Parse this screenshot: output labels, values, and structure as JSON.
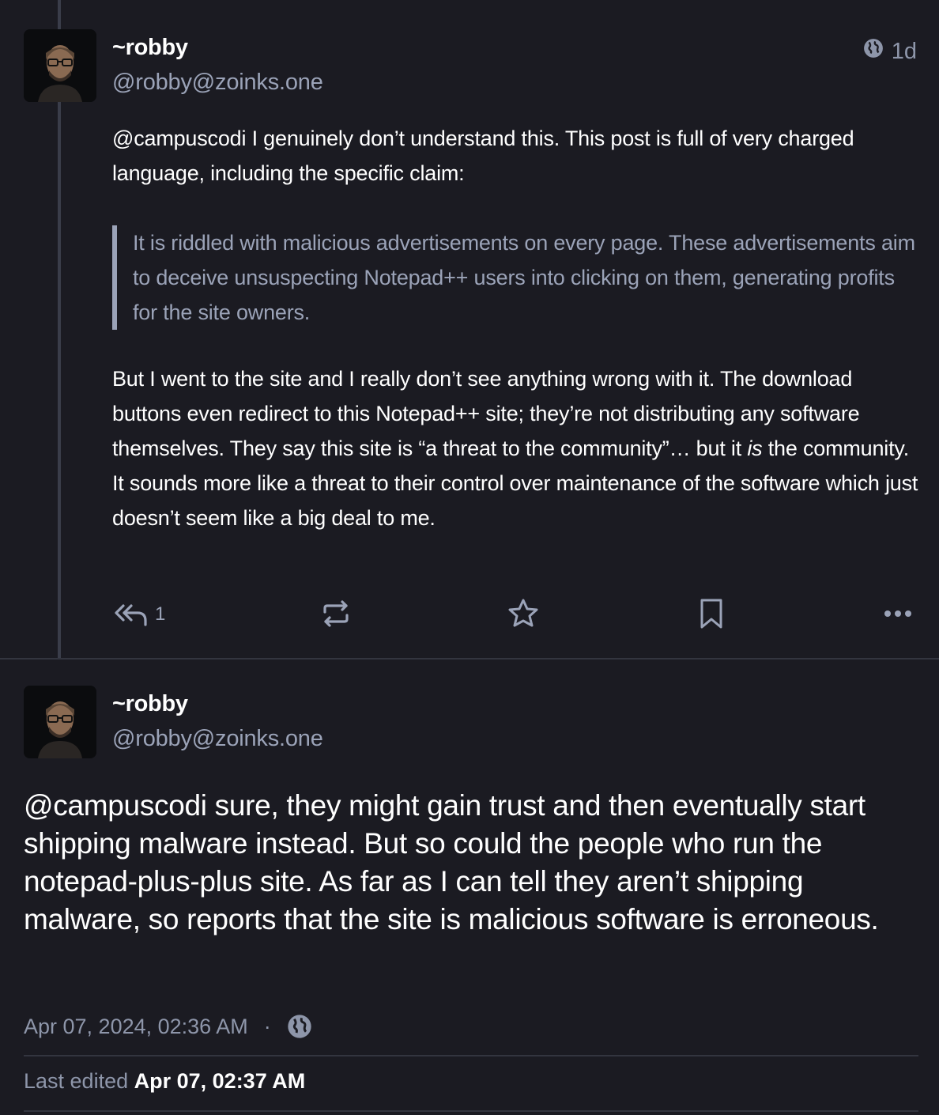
{
  "reply_post": {
    "author": {
      "display_name": "~robby",
      "handle": "@robby@zoinks.one"
    },
    "time_ago": "1d",
    "paragraph1": {
      "mention": "@campuscodi",
      "text": " I genuinely don’t understand this. This post is full of very charged language, including the specific claim:"
    },
    "quote": "It is riddled with malicious advertisements on every page. These advertisements aim to deceive unsuspecting Notepad++ users into clicking on them, generating profits for the site owners.",
    "paragraph2": {
      "before_em": "But I went to the site and I really don’t see anything wrong with it. The download buttons even redirect to this  Notepad++ site; they’re not distributing any software themselves. They say this site is “a threat to the community”… but it ",
      "em": "is",
      "after_em": " the community. It sounds more like a threat to their control over maintenance of the software which just doesn’t seem like a big deal to me."
    },
    "actions": {
      "reply_icon": "reply-all-icon",
      "reply_count": "1",
      "boost_icon": "boost-icon",
      "favourite_icon": "star-icon",
      "bookmark_icon": "bookmark-icon",
      "more_icon": "more-horizontal-icon"
    }
  },
  "focused_post": {
    "author": {
      "display_name": "~robby",
      "handle": "@robby@zoinks.one"
    },
    "mention": "@campuscodi",
    "text": " sure, they might gain trust and then eventually start shipping malware instead. But so could the people who run the notepad-plus-plus site. As far as I can tell they aren’t shipping malware, so reports that the site is malicious software is erroneous.",
    "date": "Apr 07, 2024, 02:36 AM",
    "separator": "·",
    "visibility_icon": "globe-icon",
    "edited_label": "Last edited",
    "edited_date": "Apr 07, 02:37 AM"
  },
  "colors": {
    "background": "#1b1b22",
    "text": "#ffffff",
    "muted": "#9ba3b8",
    "divider": "#33353f"
  }
}
